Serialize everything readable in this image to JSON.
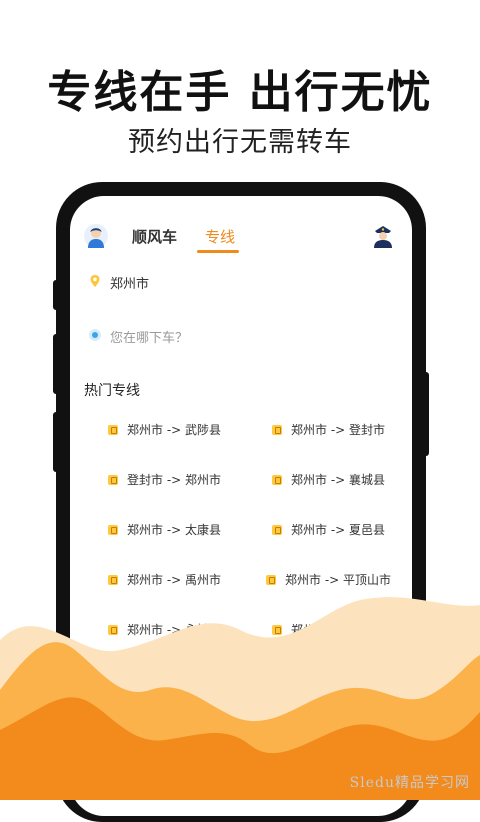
{
  "promo": {
    "headline": "专线在手 出行无忧",
    "subheadline": "预约出行无需转车"
  },
  "app": {
    "tabs": [
      {
        "label": "顺风车",
        "active": false
      },
      {
        "label": "专线",
        "active": true
      }
    ],
    "accent": "#f08a1b",
    "from_city": "郑州市",
    "to_placeholder": "您在哪下车？",
    "popular_title": "热门专线",
    "routes": [
      "郑州市 -> 武陟县",
      "郑州市 -> 登封市",
      "登封市 -> 郑州市",
      "郑州市 -> 襄城县",
      "郑州市 -> 太康县",
      "郑州市 -> 夏邑县",
      "郑州市 -> 禹州市",
      "郑州市 -> 平顶山市",
      "郑州市 -> 永城市",
      "郑州市 -> 扶沟县"
    ]
  },
  "watermark": "Sledu精品学习网",
  "icons": {
    "avatar": "driver-avatar-icon",
    "police": "police-officer-icon",
    "from_pin": "pin-icon",
    "to_dot": "target-dot-icon",
    "route": "route-icon"
  }
}
